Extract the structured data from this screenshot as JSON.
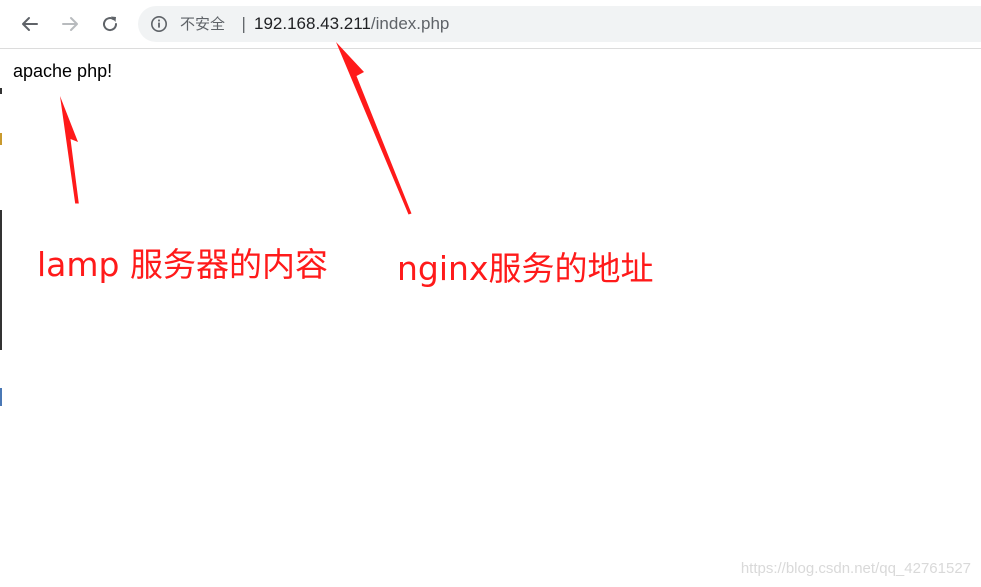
{
  "browser": {
    "security_label": "不安全",
    "separator": "|",
    "url_host": "192.168.43.211",
    "url_path": "/index.php",
    "icons": {
      "back": "back-arrow-icon",
      "forward": "forward-arrow-icon",
      "reload": "reload-icon",
      "info": "info-icon"
    }
  },
  "page": {
    "body_text": "apache php!"
  },
  "annotations": {
    "left_label": "lamp 服务器的内容",
    "right_label": "nginx服务的地址",
    "color": "#ff1a1a"
  },
  "watermark": "https://blog.csdn.net/qq_42761527"
}
